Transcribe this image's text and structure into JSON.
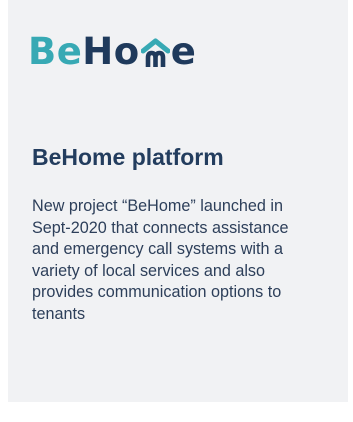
{
  "brand": {
    "logo_part_1": "Be",
    "logo_part_2": "Ho",
    "logo_part_3": "e",
    "colors": {
      "accent": "#37a9b4",
      "primary": "#1f3a5c",
      "card_background": "#f1f2f4"
    },
    "icon": "house-m-icon"
  },
  "card": {
    "title": "BeHome platform",
    "description_lines": [
      "New project “BeHome” launched in",
      "Sept-2020 that connects assistance",
      "and emergency call systems with a",
      "variety of local services and also",
      "provides communication options to",
      "tenants"
    ]
  }
}
